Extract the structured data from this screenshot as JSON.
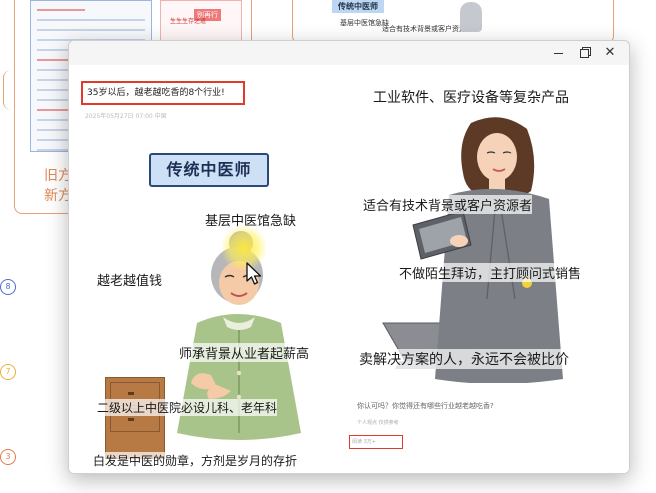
{
  "background": {
    "left_note_lines": [
      "旧方",
      "新方"
    ],
    "right_banner": "传统中医师",
    "right_caption_1": "基层中医馆急缺",
    "right_caption_2": "适合有技术背景或客户资源者",
    "left_thumb_tag": "别再行",
    "left_thumb_red": "生生生存之道",
    "step_numbers": [
      "8",
      "7",
      "3"
    ]
  },
  "window": {
    "controls": {
      "minimize": "minimize",
      "maximize": "maximize",
      "close": "✕"
    }
  },
  "article": {
    "header": "35岁以后，越老越吃香的8个行业!",
    "date": "2025年05月27日 07:00 中国"
  },
  "left_image": {
    "title": "传统中医师",
    "captions": {
      "shortage": "基层中医馆急缺",
      "value": "越老越值钱",
      "mentor": "师承背景从业者起薪高",
      "hospital": "二级以上中医院必设儿科、老年科",
      "white_hair": "白发是中医的勋章，方剂是岁月的存折"
    }
  },
  "right_image": {
    "captions": {
      "industry": "工业软件、医疗设备等复杂产品",
      "tech": "适合有技术背景或客户资源者",
      "no_cold": "不做陌生拜访，主打顾问式销售",
      "solution": "卖解决方案的人，永远不会被比价"
    },
    "question": "你认可吗？你觉得还有哪些行业越老越吃香?",
    "sub_stats": "个人观点  仅供参考",
    "stat_box": "阅读 3万+"
  },
  "colors": {
    "highlight_red": "#e03b2a",
    "accent_orange": "#e08a57",
    "badge_blue": "#cde0f6"
  }
}
